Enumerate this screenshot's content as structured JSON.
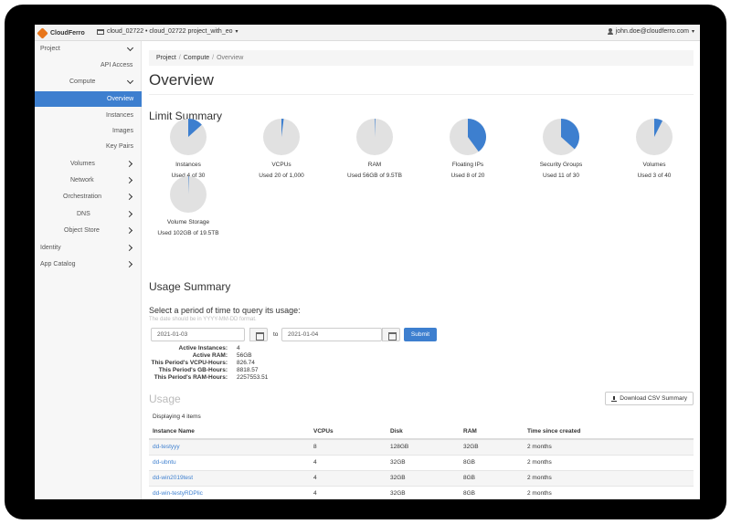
{
  "topbar": {
    "brand": "CloudFerro",
    "project_switch": "cloud_02722 • cloud_02722 project_with_eo",
    "user": "john.doe@cloudferro.com"
  },
  "sidebar": {
    "items": [
      {
        "label": "Project"
      },
      {
        "label": "API Access"
      },
      {
        "label": "Compute"
      },
      {
        "label": "Overview"
      },
      {
        "label": "Instances"
      },
      {
        "label": "Images"
      },
      {
        "label": "Key Pairs"
      },
      {
        "label": "Volumes"
      },
      {
        "label": "Network"
      },
      {
        "label": "Orchestration"
      },
      {
        "label": "DNS"
      },
      {
        "label": "Object Store"
      },
      {
        "label": "Identity"
      },
      {
        "label": "App Catalog"
      }
    ]
  },
  "breadcrumb": [
    "Project",
    "Compute",
    "Overview"
  ],
  "page_title": "Overview",
  "limit_summary": {
    "title": "Limit Summary",
    "pies": [
      {
        "label": "Instances",
        "used_text": "Used 4 of 30",
        "fraction": 0.133
      },
      {
        "label": "VCPUs",
        "used_text": "Used 20 of 1,000",
        "fraction": 0.02
      },
      {
        "label": "RAM",
        "used_text": "Used 56GB of 9.5TB",
        "fraction": 0.006
      },
      {
        "label": "Floating IPs",
        "used_text": "Used 8 of 20",
        "fraction": 0.4
      },
      {
        "label": "Security Groups",
        "used_text": "Used 11 of 30",
        "fraction": 0.367
      },
      {
        "label": "Volumes",
        "used_text": "Used 3 of 40",
        "fraction": 0.075
      },
      {
        "label": "Volume Storage",
        "used_text": "Used 102GB of 19.5TB",
        "fraction": 0.005
      }
    ],
    "colors": {
      "used": "#3d7fcf",
      "free": "#e1e1e1"
    }
  },
  "usage_summary": {
    "title": "Usage Summary",
    "query_title": "Select a period of time to query its usage:",
    "help": "The date should be in YYYY-MM-DD format.",
    "start_date": "2021-01-03",
    "to_label": "to",
    "end_date": "2021-01-04",
    "submit": "Submit",
    "stats": [
      {
        "key": "Active Instances:",
        "value": "4"
      },
      {
        "key": "Active RAM:",
        "value": "56GB"
      },
      {
        "key": "This Period's VCPU-Hours:",
        "value": "826.74"
      },
      {
        "key": "This Period's GB-Hours:",
        "value": "8818.57"
      },
      {
        "key": "This Period's RAM-Hours:",
        "value": "2257553.51"
      }
    ]
  },
  "usage": {
    "title": "Usage",
    "csv_button": "Download CSV Summary",
    "displaying": "Displaying 4 items",
    "columns": [
      "Instance Name",
      "VCPUs",
      "Disk",
      "RAM",
      "Time since created"
    ],
    "rows": [
      [
        "dd-testyyy",
        "8",
        "128GB",
        "32GB",
        "2 months"
      ],
      [
        "dd-ubntu",
        "4",
        "32GB",
        "8GB",
        "2 months"
      ],
      [
        "dd-win2019test",
        "4",
        "32GB",
        "8GB",
        "2 months"
      ],
      [
        "dd-win-testyRDPlic",
        "4",
        "32GB",
        "8GB",
        "2 months"
      ]
    ]
  }
}
